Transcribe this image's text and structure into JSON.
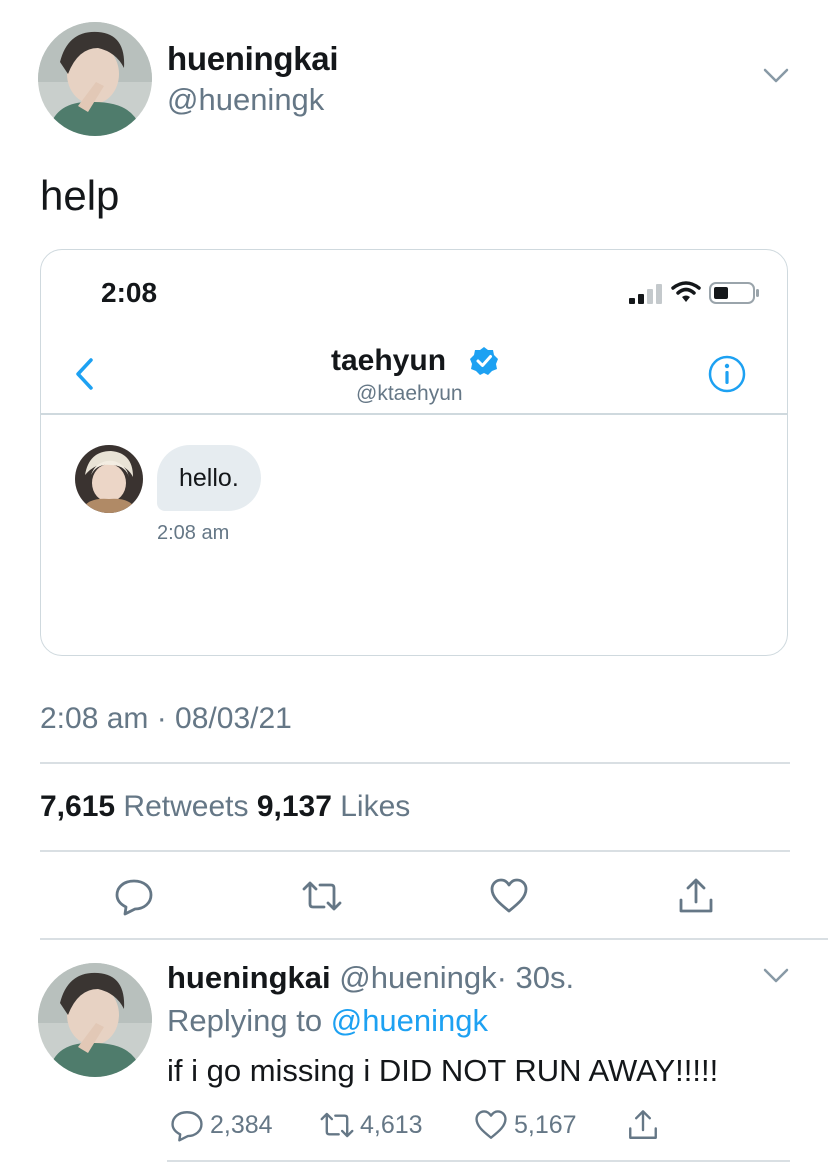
{
  "tweet": {
    "author_name": "hueningkai",
    "author_handle": "@hueningk",
    "text": "help",
    "meta": "2:08 am · 08/03/21",
    "stats": {
      "retweet_count": "7,615",
      "retweet_label": "Retweets",
      "like_count": "9,137",
      "like_label": "Likes"
    },
    "icons": [
      "reply-icon",
      "retweet-icon",
      "like-icon",
      "share-icon"
    ]
  },
  "embedded_screenshot": {
    "status_time": "2:08",
    "dm_name": "taehyun",
    "dm_handle": "@ktaehyun",
    "message": "hello.",
    "message_time": "2:08 am"
  },
  "reply": {
    "author_name": "hueningkai",
    "author_handle": "@hueningk",
    "time": "· 30s.",
    "replying_prefix": "Replying to",
    "replying_to": "@hueningk",
    "text": "if i go missing i DID NOT RUN AWAY!!!!!",
    "reply_count": "2,384",
    "retweet_count": "4,613",
    "like_count": "5,167"
  },
  "colors": {
    "text": "#14171a",
    "secondary": "#657786",
    "accent": "#1da1f2",
    "divider": "#d9dfe3",
    "bubble": "#e6ecf0"
  }
}
